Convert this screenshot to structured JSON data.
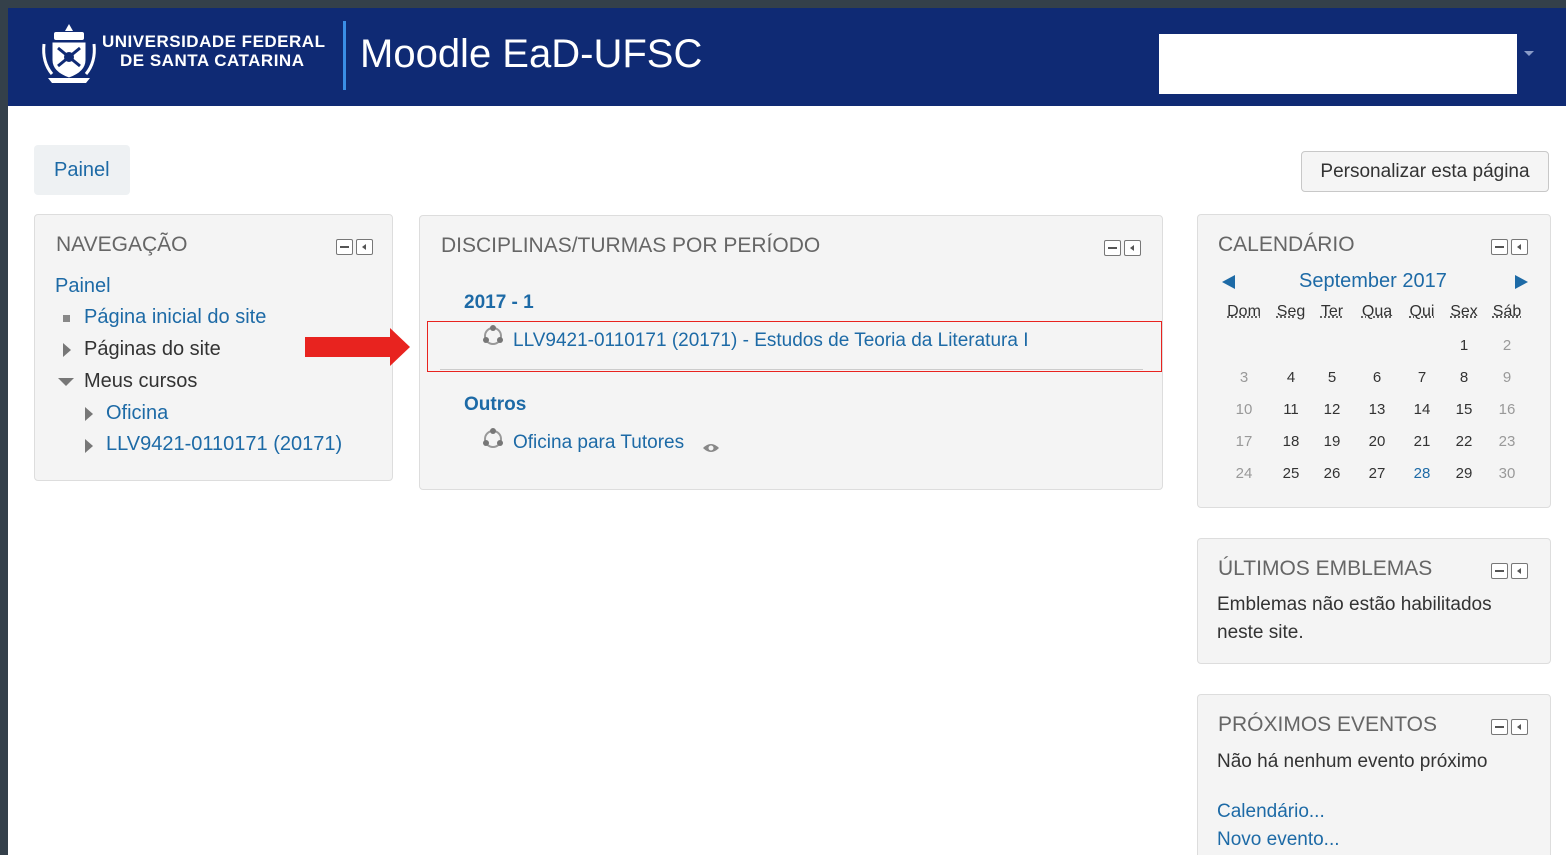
{
  "header": {
    "university_line1": "UNIVERSIDADE FEDERAL",
    "university_line2": "DE SANTA CATARINA",
    "site_title": "Moodle EaD-UFSC"
  },
  "breadcrumb": {
    "label": "Painel"
  },
  "customize_button": "Personalizar esta página",
  "navigation": {
    "title": "NAVEGAÇÃO",
    "root": "Painel",
    "items": [
      {
        "label": "Página inicial do site"
      },
      {
        "label": "Páginas do site"
      },
      {
        "label": "Meus cursos"
      }
    ],
    "my_courses": [
      {
        "label": "Oficina"
      },
      {
        "label": "LLV9421-0110171 (20171)"
      }
    ]
  },
  "courses_block": {
    "title": "DISCIPLINAS/TURMAS POR PERÍODO",
    "groups": [
      {
        "period": "2017 - 1",
        "courses": [
          {
            "label": "LLV9421-0110171 (20171) - Estudos de Teoria da Literatura I"
          }
        ]
      },
      {
        "period": "Outros",
        "courses": [
          {
            "label": "Oficina para Tutores"
          }
        ]
      }
    ]
  },
  "calendar": {
    "title": "CALENDÁRIO",
    "month": "September 2017",
    "weekdays": [
      "Dom",
      "Seg",
      "Ter",
      "Qua",
      "Qui",
      "Sex",
      "Sáb"
    ],
    "weeks": [
      [
        "",
        "",
        "",
        "",
        "",
        "1",
        "2"
      ],
      [
        "3",
        "4",
        "5",
        "6",
        "7",
        "8",
        "9"
      ],
      [
        "10",
        "11",
        "12",
        "13",
        "14",
        "15",
        "16"
      ],
      [
        "17",
        "18",
        "19",
        "20",
        "21",
        "22",
        "23"
      ],
      [
        "24",
        "25",
        "26",
        "27",
        "28",
        "29",
        "30"
      ]
    ],
    "today": "28"
  },
  "badges_block": {
    "title": "ÚLTIMOS EMBLEMAS",
    "text_line1": "Emblemas não estão habilitados",
    "text_line2": "neste site."
  },
  "events_block": {
    "title": "PRÓXIMOS EVENTOS",
    "text": "Não há nenhum evento próximo",
    "links": [
      "Calendário...",
      "Novo evento..."
    ]
  },
  "colors": {
    "navbar": "#0f2a74",
    "link": "#1d6aa6",
    "highlight": "#e8231f"
  }
}
